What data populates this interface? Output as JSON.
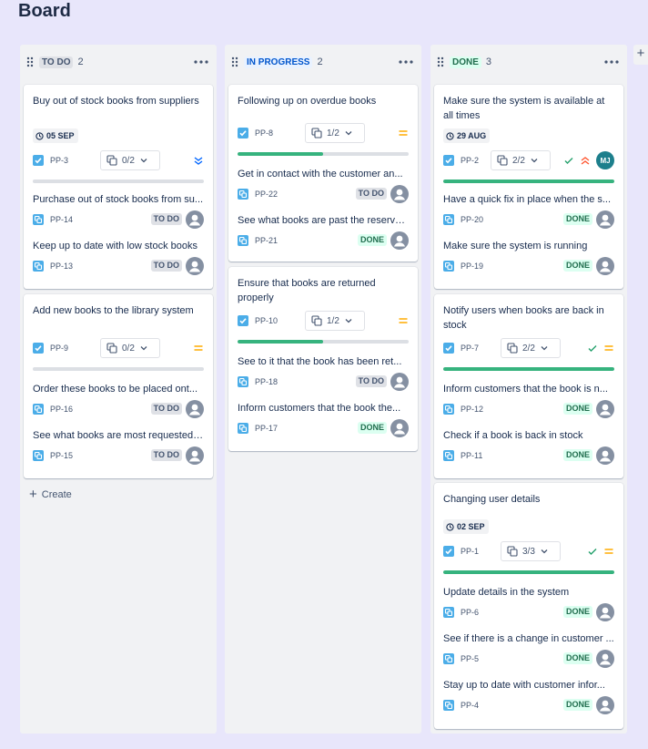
{
  "board": {
    "title": "Board",
    "add_column": "+"
  },
  "columns": [
    {
      "name": "TO DO",
      "count": "2",
      "create_label": "Create",
      "cards": [
        {
          "title": "Buy out of stock books from suppliers",
          "date": "05 SEP",
          "key": "PP-3",
          "subtasks": "0/2",
          "progress": 0,
          "priority": "lowest",
          "children": [
            {
              "title": "Purchase out of stock books from su...",
              "key": "PP-14",
              "status": "TO DO"
            },
            {
              "title": "Keep up to date with low stock books",
              "key": "PP-13",
              "status": "TO DO"
            }
          ]
        },
        {
          "title": "Add new books to the library system",
          "key": "PP-9",
          "subtasks": "0/2",
          "progress": 0,
          "priority": "medium",
          "children": [
            {
              "title": "Order these books to be placed ont...",
              "key": "PP-16",
              "status": "TO DO"
            },
            {
              "title": "See what books are most requested ...",
              "key": "PP-15",
              "status": "TO DO"
            }
          ]
        }
      ]
    },
    {
      "name": "IN PROGRESS",
      "count": "2",
      "cards": [
        {
          "title": "Following up on overdue books",
          "key": "PP-8",
          "subtasks": "1/2",
          "progress": 0.5,
          "priority": "medium",
          "children": [
            {
              "title": "Get in contact with the customer an...",
              "key": "PP-22",
              "status": "TO DO"
            },
            {
              "title": "See what books are past the reserva...",
              "key": "PP-21",
              "status": "DONE"
            }
          ]
        },
        {
          "title": "Ensure that books are returned properly",
          "key": "PP-10",
          "subtasks": "1/2",
          "progress": 0.5,
          "priority": "medium",
          "children": [
            {
              "title": "See to it that the book has been ret...",
              "key": "PP-18",
              "status": "TO DO"
            },
            {
              "title": "Inform customers that the book the...",
              "key": "PP-17",
              "status": "DONE"
            }
          ]
        }
      ]
    },
    {
      "name": "DONE",
      "count": "3",
      "cards": [
        {
          "title": "Make sure the system is available at all times",
          "date": "29 AUG",
          "key": "PP-2",
          "subtasks": "2/2",
          "progress": 1,
          "priority": "highest",
          "assignee": "MJ",
          "children": [
            {
              "title": "Have a quick fix in place when the s...",
              "key": "PP-20",
              "status": "DONE"
            },
            {
              "title": "Make sure the system is running",
              "key": "PP-19",
              "status": "DONE"
            }
          ]
        },
        {
          "title": "Notify users when books are back in stock",
          "key": "PP-7",
          "subtasks": "2/2",
          "progress": 1,
          "priority": "medium",
          "children": [
            {
              "title": "Inform customers that the book is n...",
              "key": "PP-12",
              "status": "DONE"
            },
            {
              "title": "Check if a book is back in stock",
              "key": "PP-11",
              "status": "DONE"
            }
          ]
        },
        {
          "title": "Changing user details",
          "date": "02 SEP",
          "key": "PP-1",
          "subtasks": "3/3",
          "progress": 1,
          "priority": "medium",
          "children": [
            {
              "title": "Update details in the system",
              "key": "PP-6",
              "status": "DONE"
            },
            {
              "title": "See if there is a change in customer ...",
              "key": "PP-5",
              "status": "DONE"
            },
            {
              "title": "Stay up to date with customer infor...",
              "key": "PP-4",
              "status": "DONE"
            }
          ]
        }
      ]
    }
  ],
  "colors": {
    "background": "#e8e6fb",
    "column": "#f1f2f4",
    "progress_fill": "#36b37e",
    "progress_track": "#dcdfe4",
    "checkbox": "#4bade8",
    "subtask_icon": "#4bade8",
    "priority_medium": "#ffab00",
    "priority_lowest": "#0065ff",
    "priority_highest": "#ff5630",
    "todo_lozenge": "#dfe1e6",
    "done_lozenge": "#dcfff1",
    "progress_lozenge": "#e9f2ff"
  }
}
